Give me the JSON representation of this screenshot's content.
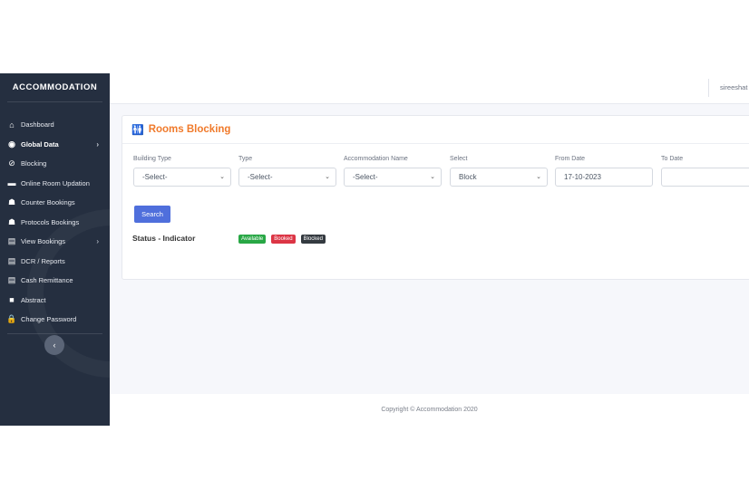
{
  "sidebar": {
    "brand": "ACCOMMODATION",
    "items": [
      {
        "label": "Dashboard",
        "icon": "home-icon",
        "glyph": "⌂",
        "bold": false,
        "chevron": false
      },
      {
        "label": "Global Data",
        "icon": "globe-icon",
        "glyph": "◉",
        "bold": true,
        "chevron": true
      },
      {
        "label": "Blocking",
        "icon": "ban-icon",
        "glyph": "⊘",
        "bold": false,
        "chevron": false
      },
      {
        "label": "Online Room Updation",
        "icon": "bed-icon",
        "glyph": "▬",
        "bold": false,
        "chevron": false
      },
      {
        "label": "Counter Bookings",
        "icon": "users-icon",
        "glyph": "☗",
        "bold": false,
        "chevron": false
      },
      {
        "label": "Protocols Bookings",
        "icon": "users-icon",
        "glyph": "☗",
        "bold": false,
        "chevron": false
      },
      {
        "label": "View Bookings",
        "icon": "pdf-icon",
        "glyph": "▤",
        "bold": false,
        "chevron": true
      },
      {
        "label": "DCR / Reports",
        "icon": "word-icon",
        "glyph": "▤",
        "bold": false,
        "chevron": false
      },
      {
        "label": "Cash Remittance",
        "icon": "word-icon",
        "glyph": "▤",
        "bold": false,
        "chevron": false
      },
      {
        "label": "Abstract",
        "icon": "note-icon",
        "glyph": "■",
        "bold": false,
        "chevron": false
      },
      {
        "label": "Change Password",
        "icon": "lock-icon",
        "glyph": "🔒",
        "bold": false,
        "chevron": false
      }
    ],
    "collapse_glyph": "‹"
  },
  "topbar": {
    "user": "sireeshat"
  },
  "card": {
    "title": "Rooms Blocking",
    "icon_glyph": "🚻",
    "fields": [
      {
        "label": "Building Type",
        "value": "-Select-",
        "kind": "select"
      },
      {
        "label": "Type",
        "value": "-Select-",
        "kind": "select"
      },
      {
        "label": "Accommodation Name",
        "value": "-Select-",
        "kind": "select"
      },
      {
        "label": "Select",
        "value": "Block",
        "kind": "select"
      },
      {
        "label": "From Date",
        "value": "17-10-2023",
        "kind": "input"
      },
      {
        "label": "To Date",
        "value": "",
        "kind": "input"
      }
    ],
    "search_label": "Search",
    "status_label": "Status - Indicator",
    "badges": [
      {
        "label": "Available",
        "color": "#28a745"
      },
      {
        "label": "Booked",
        "color": "#dc3545"
      },
      {
        "label": "Blocked",
        "color": "#343a40"
      }
    ]
  },
  "footer": {
    "text": "Copyright © Accommodation 2020"
  }
}
